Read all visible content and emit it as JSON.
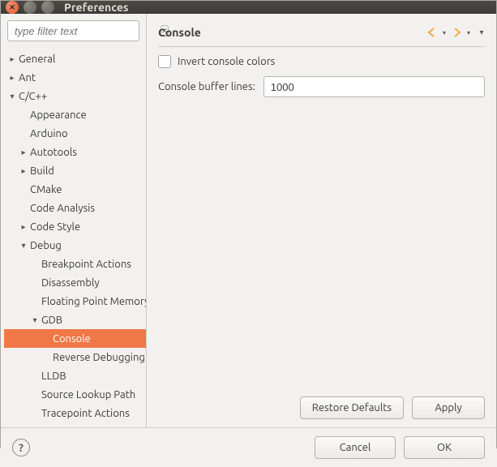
{
  "window": {
    "title": "Preferences"
  },
  "filter": {
    "placeholder": "type filter text"
  },
  "tree": [
    {
      "label": "General",
      "depth": 0,
      "exp": "▸",
      "sel": false
    },
    {
      "label": "Ant",
      "depth": 0,
      "exp": "▸",
      "sel": false
    },
    {
      "label": "C/C++",
      "depth": 0,
      "exp": "▾",
      "sel": false
    },
    {
      "label": "Appearance",
      "depth": 1,
      "exp": "",
      "sel": false
    },
    {
      "label": "Arduino",
      "depth": 1,
      "exp": "",
      "sel": false
    },
    {
      "label": "Autotools",
      "depth": 1,
      "exp": "▸",
      "sel": false
    },
    {
      "label": "Build",
      "depth": 1,
      "exp": "▸",
      "sel": false
    },
    {
      "label": "CMake",
      "depth": 1,
      "exp": "",
      "sel": false
    },
    {
      "label": "Code Analysis",
      "depth": 1,
      "exp": "",
      "sel": false
    },
    {
      "label": "Code Style",
      "depth": 1,
      "exp": "▸",
      "sel": false
    },
    {
      "label": "Debug",
      "depth": 1,
      "exp": "▾",
      "sel": false
    },
    {
      "label": "Breakpoint Actions",
      "depth": 2,
      "exp": "",
      "sel": false
    },
    {
      "label": "Disassembly",
      "depth": 2,
      "exp": "",
      "sel": false
    },
    {
      "label": "Floating Point Memory",
      "depth": 2,
      "exp": "",
      "sel": false
    },
    {
      "label": "GDB",
      "depth": 2,
      "exp": "▾",
      "sel": false
    },
    {
      "label": "Console",
      "depth": 3,
      "exp": "",
      "sel": true
    },
    {
      "label": "Reverse Debugging",
      "depth": 3,
      "exp": "",
      "sel": false
    },
    {
      "label": "LLDB",
      "depth": 2,
      "exp": "",
      "sel": false
    },
    {
      "label": "Source Lookup Path",
      "depth": 2,
      "exp": "",
      "sel": false
    },
    {
      "label": "Tracepoint Actions",
      "depth": 2,
      "exp": "",
      "sel": false
    }
  ],
  "page": {
    "heading": "Console",
    "invert_label": "Invert console colors",
    "invert_checked": false,
    "buffer_label": "Console buffer lines:",
    "buffer_value": "1000"
  },
  "buttons": {
    "restore": "Restore Defaults",
    "apply": "Apply",
    "cancel": "Cancel",
    "ok": "OK"
  },
  "colors": {
    "selection": "#f07746",
    "nav_arrow": "#f3a946"
  }
}
